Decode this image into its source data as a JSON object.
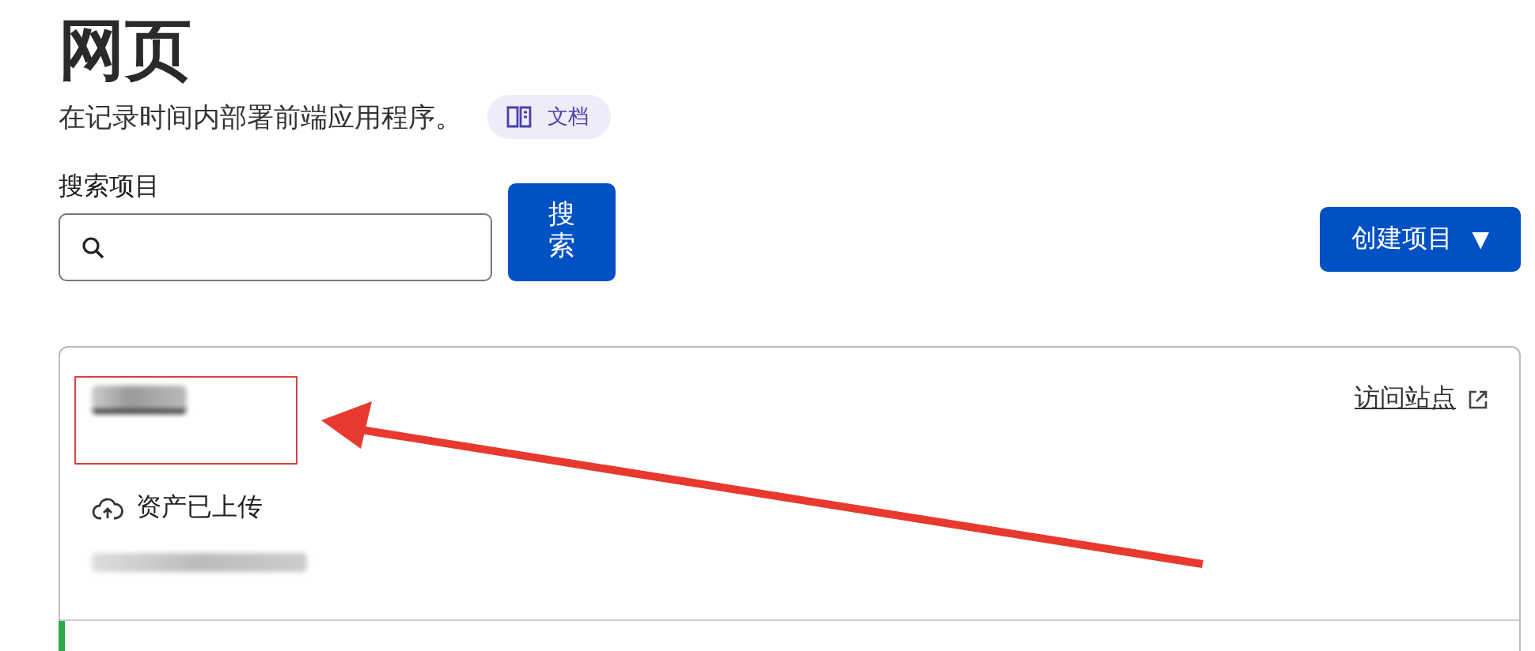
{
  "page": {
    "title": "网页",
    "description": "在记录时间内部署前端应用程序。",
    "docs_badge": "文档"
  },
  "search": {
    "label": "搜索项目",
    "button": "搜索"
  },
  "create_button": {
    "label": "创建项目",
    "caret": "▼"
  },
  "projects": [
    {
      "status": "资产已上传",
      "link": "访问站点"
    }
  ]
}
